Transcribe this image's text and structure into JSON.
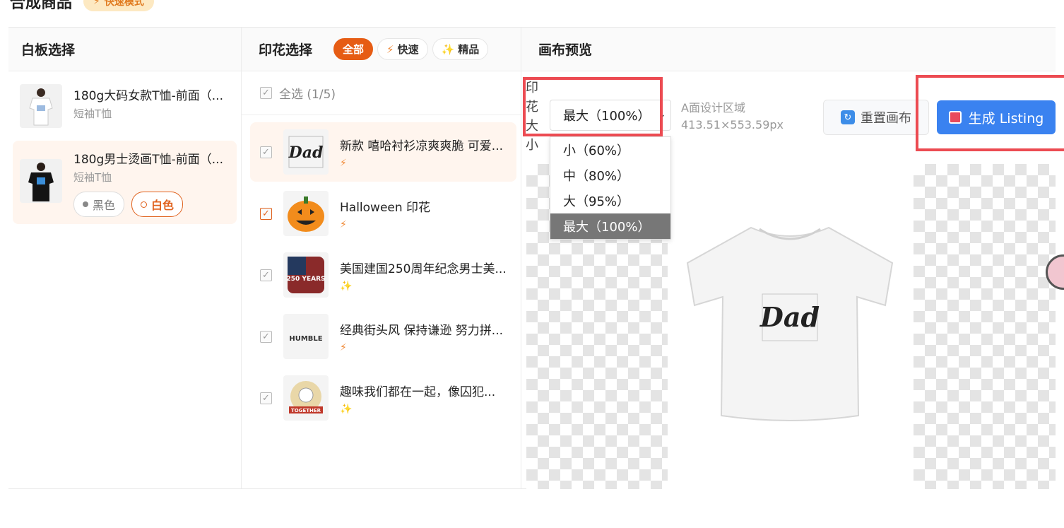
{
  "header": {
    "title": "合成商品",
    "mode_badge": "快速模式"
  },
  "left": {
    "title": "白板选择",
    "items": [
      {
        "title": "180g大码女款T恤-前面（...",
        "subtitle": "短袖T恤"
      },
      {
        "title": "180g男士烫画T恤-前面（...",
        "subtitle": "短袖T恤",
        "colors": [
          "黑色",
          "白色"
        ],
        "selected_color": "白色"
      }
    ]
  },
  "middle": {
    "title": "印花选择",
    "filters": [
      "全部",
      "快速",
      "精品"
    ],
    "select_all": "全选 (1/5)",
    "prints": [
      {
        "title": "新款 嘻哈衬衫凉爽爽脆 可爱...",
        "type": "fast",
        "thumb_text": "Dad"
      },
      {
        "title": "Halloween 印花",
        "type": "fast"
      },
      {
        "title": "美国建国250周年纪念男士美...",
        "type": "premium",
        "thumb_text": "250 YEARS"
      },
      {
        "title": "经典街头风 保持谦逊 努力拼...",
        "type": "fast",
        "thumb_text": "HUMBLE"
      },
      {
        "title": "趣味我们都在一起，像囚犯...",
        "type": "premium",
        "thumb_text": "TOGETHER"
      }
    ],
    "icons": {
      "fast": "⚡",
      "premium": "✨"
    }
  },
  "right": {
    "title": "画布预览",
    "size_label": "印花大小",
    "size_value": "最大（100%）",
    "size_options": [
      "小（60%）",
      "中（80%）",
      "大（95%）",
      "最大（100%）"
    ],
    "area_name": "A面设计区域",
    "area_size": "413.51×553.59px",
    "reset_label": "重置画布",
    "generate_label": "生成 Listing",
    "tee_print_text": "Dad"
  },
  "colors": {
    "accent": "#e65c14",
    "primary": "#3a82f0",
    "highlight": "#ec4b52"
  }
}
